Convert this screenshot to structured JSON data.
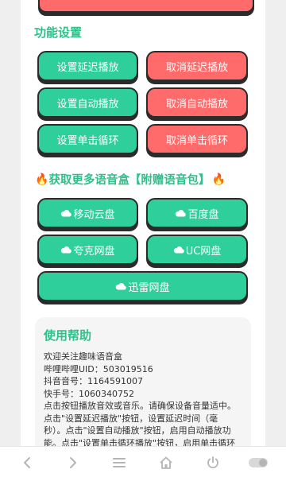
{
  "section_title": "功能设置",
  "buttons": {
    "set_delay": "设置延迟播放",
    "cancel_delay": "取消延迟播放",
    "set_auto": "设置自动播放",
    "cancel_auto": "取消自动播放",
    "set_loop": "设置单击循环",
    "cancel_loop": "取消单击循环"
  },
  "promo": {
    "text": "获取更多语音盒【附赠语音包】",
    "icon": "fire-icon"
  },
  "cloud_buttons": {
    "mobile_cloud": "移动云盘",
    "baidu": "百度盘",
    "quark": "夸克网盘",
    "uc": "UC网盘",
    "xunlei": "迅雷网盘"
  },
  "help": {
    "title": "使用帮助",
    "lines": [
      "欢迎关注趣味语音盒",
      "哔哩哔哩UID：503019516",
      "抖音音号：1164591007",
      "快手号：1060340752",
      "点击按钮播放音效或音乐。请确保设备音量适中。",
      "点击\"设置延迟播放\"按钮，设置延迟时间（毫",
      "秒）。点击\"设置自动播放\"按钮，启用自动播放功",
      "能。点击\"设置单击循环播放\"按钮，启用单击循环"
    ]
  },
  "nav": {
    "icons": [
      "back-icon",
      "forward-icon",
      "menu-icon",
      "home-icon",
      "power-icon",
      "toggle-icon"
    ]
  },
  "colors": {
    "green": "#2ecf9a",
    "red": "#ff6b6b",
    "title_green": "#2fbf8a"
  }
}
